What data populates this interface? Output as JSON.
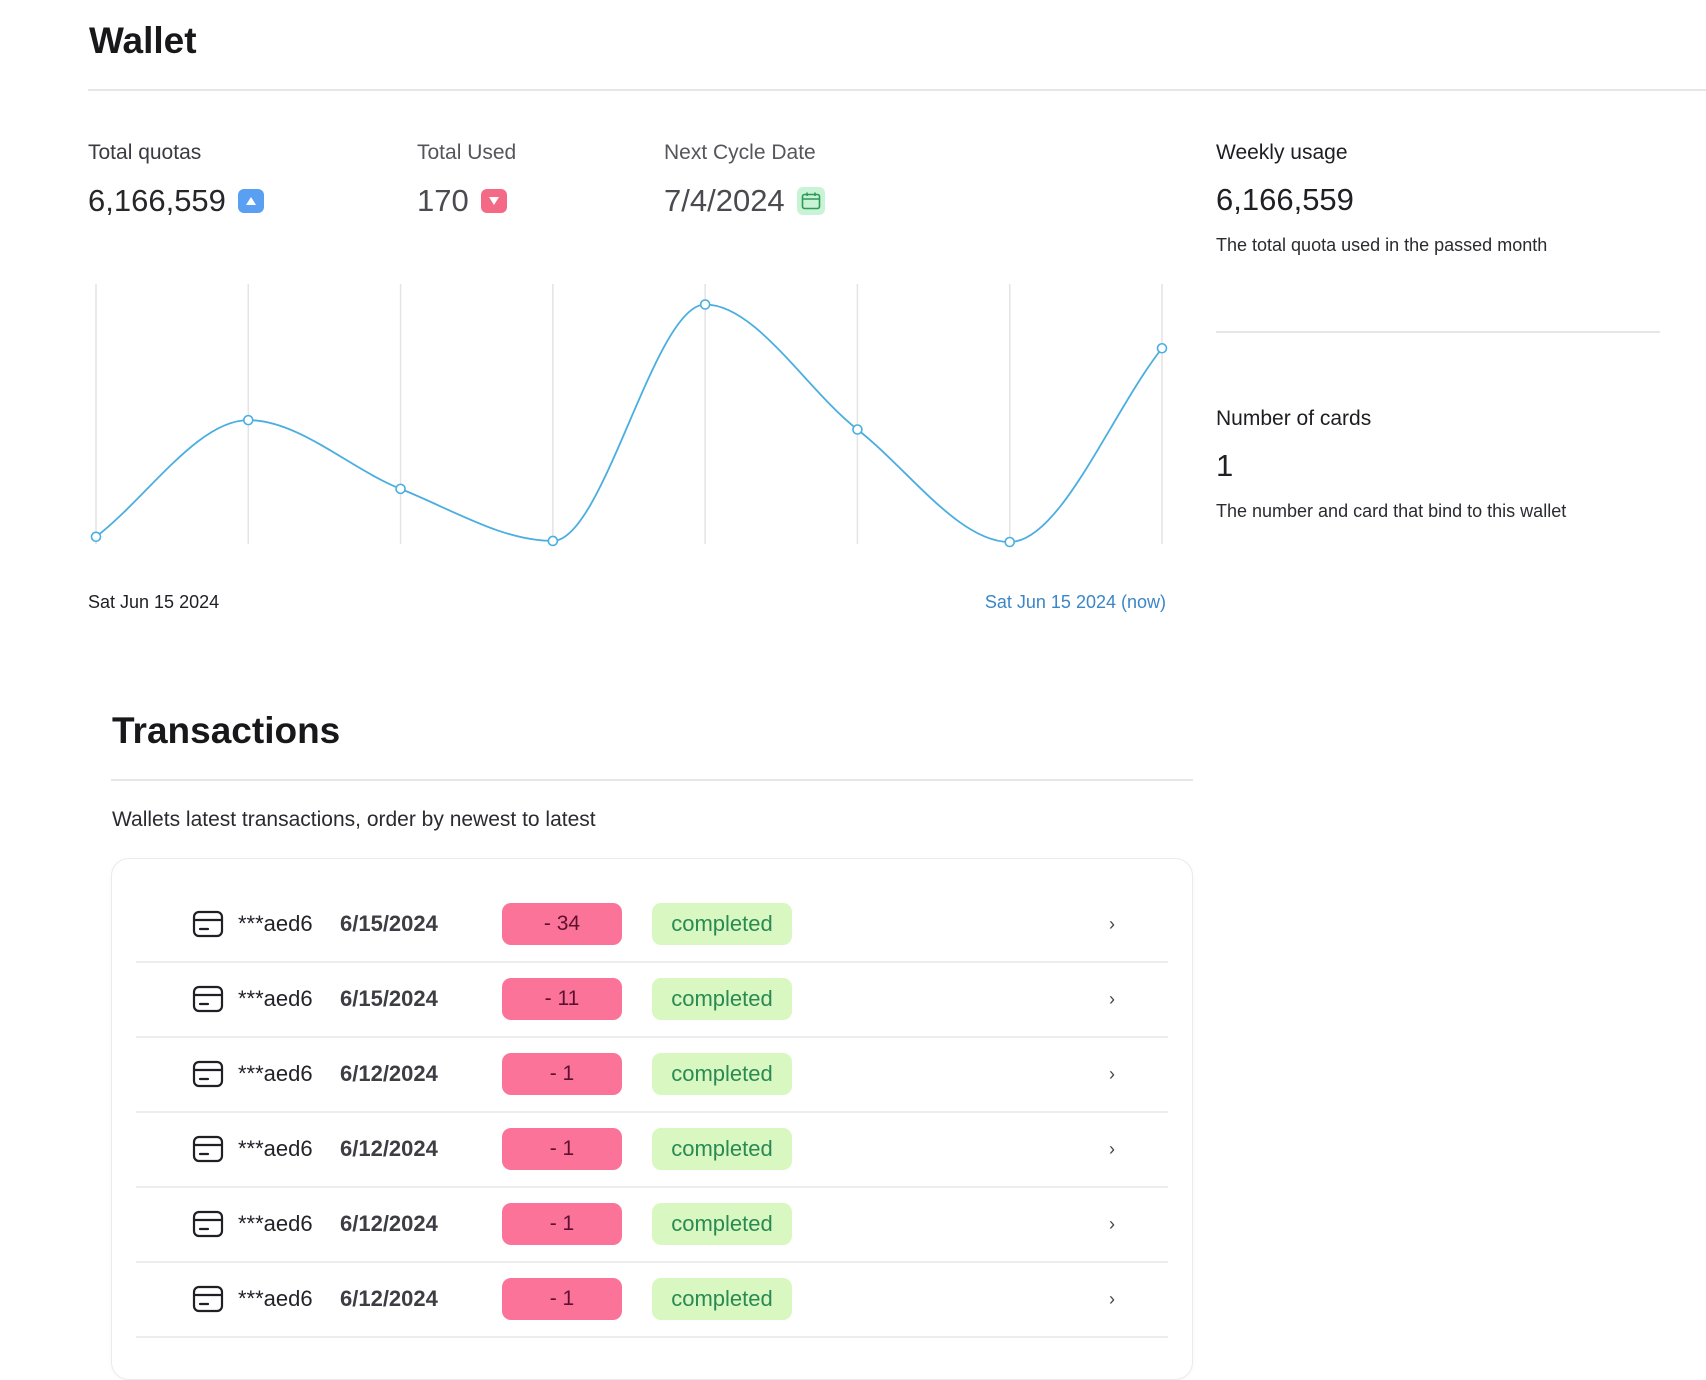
{
  "header": {
    "title": "Wallet"
  },
  "stats": [
    {
      "label": "Total quotas",
      "value": "6,166,559",
      "icon": "caret-up-icon",
      "color": "#5aa0f2"
    },
    {
      "label": "Total Used",
      "value": "170",
      "icon": "caret-down-icon",
      "color": "#f46a86"
    },
    {
      "label": "Next Cycle Date",
      "value": "7/4/2024",
      "icon": "calendar-icon",
      "color": "#c9f3d6"
    }
  ],
  "side": {
    "weekly": {
      "label": "Weekly usage",
      "value": "6,166,559",
      "description": "The total quota used in the passed month"
    },
    "cards": {
      "label": "Number of cards",
      "value": "1",
      "description": "The number and card that bind to this wallet"
    }
  },
  "chart_data": {
    "type": "line",
    "x_start_label": "Sat Jun 15 2024",
    "x_end_label": "Sat Jun 15 2024 (now)",
    "values": [
      5,
      117,
      51,
      1,
      228,
      108,
      0,
      186
    ],
    "ylim": [
      0,
      240
    ],
    "grid": "vertical",
    "line_color": "#4aaee0"
  },
  "transactions": {
    "title": "Transactions",
    "subtitle": "Wallets latest transactions, order by newest to latest",
    "rows": [
      {
        "card": "***aed6",
        "date": "6/15/2024",
        "amount": "- 34",
        "status": "completed"
      },
      {
        "card": "***aed6",
        "date": "6/15/2024",
        "amount": "- 11",
        "status": "completed"
      },
      {
        "card": "***aed6",
        "date": "6/12/2024",
        "amount": "- 1",
        "status": "completed"
      },
      {
        "card": "***aed6",
        "date": "6/12/2024",
        "amount": "- 1",
        "status": "completed"
      },
      {
        "card": "***aed6",
        "date": "6/12/2024",
        "amount": "- 1",
        "status": "completed"
      },
      {
        "card": "***aed6",
        "date": "6/12/2024",
        "amount": "- 1",
        "status": "completed"
      }
    ]
  }
}
